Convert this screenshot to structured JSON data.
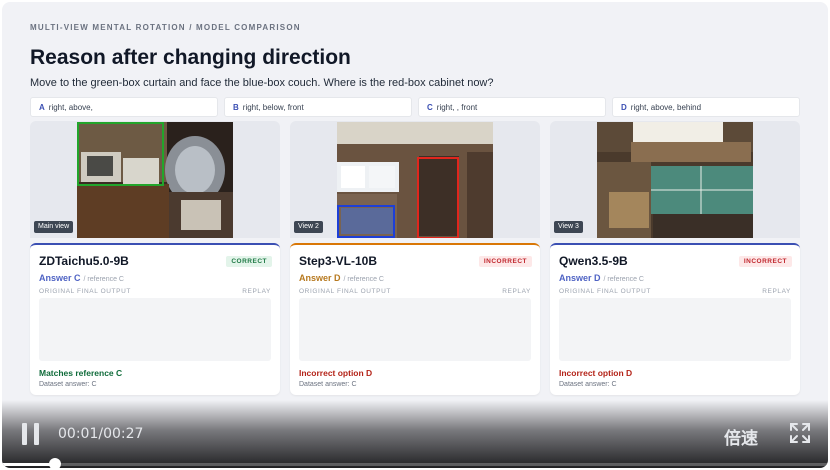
{
  "header": {
    "eyebrow": "MULTI-VIEW MENTAL ROTATION / MODEL COMPARISON",
    "title": "Reason after changing direction",
    "question": "Move to the green-box curtain and face the blue-box couch. Where is the red-box cabinet now?"
  },
  "options": [
    {
      "letter": "A",
      "text": "right, above,"
    },
    {
      "letter": "B",
      "text": "right, below, front"
    },
    {
      "letter": "C",
      "text": "right, , front"
    },
    {
      "letter": "D",
      "text": "right, above, behind"
    }
  ],
  "views": [
    {
      "label": "Main view",
      "box_color": "#22a52b",
      "box_name": "green-box"
    },
    {
      "label": "View 2",
      "box_color": "#e0261d",
      "box_name": "red-box",
      "box2_color": "#1d3fd8",
      "box2_name": "blue-box"
    },
    {
      "label": "View 3"
    }
  ],
  "models": [
    {
      "name": "ZDTaichu5.0-9B",
      "badge": "CORRECT",
      "answer": "Answer C",
      "reference": "/ reference C",
      "output_label": "ORIGINAL FINAL OUTPUT",
      "replay": "REPLAY",
      "verdict": "Matches reference C",
      "dataset": "Dataset answer: C",
      "accent": "#3b4fb3",
      "answer_color": "#4f63c4",
      "verdict_color": "#0f6b3a",
      "badge_bg": "#e3f4ea",
      "badge_fg": "#1f7a45"
    },
    {
      "name": "Step3-VL-10B",
      "badge": "INCORRECT",
      "answer": "Answer D",
      "reference": "/ reference C",
      "output_label": "ORIGINAL FINAL OUTPUT",
      "replay": "REPLAY",
      "verdict": "Incorrect option D",
      "dataset": "Dataset answer: C",
      "accent": "#d97706",
      "answer_color": "#b7791f",
      "verdict_color": "#b42318",
      "badge_bg": "#fde8e8",
      "badge_fg": "#c0262d"
    },
    {
      "name": "Qwen3.5-9B",
      "badge": "INCORRECT",
      "answer": "Answer D",
      "reference": "/ reference C",
      "output_label": "ORIGINAL FINAL OUTPUT",
      "replay": "REPLAY",
      "verdict": "Incorrect option D",
      "dataset": "Dataset answer: C",
      "accent": "#3b4fb3",
      "answer_color": "#4f63c4",
      "verdict_color": "#b42318",
      "badge_bg": "#fde8e8",
      "badge_fg": "#c0262d"
    }
  ],
  "player": {
    "time": "00:01/00:27",
    "speed_label": "倍速",
    "progress_fraction": 0.064,
    "pause_icon": "pause-icon",
    "fullscreen_icon": "fullscreen-icon"
  }
}
